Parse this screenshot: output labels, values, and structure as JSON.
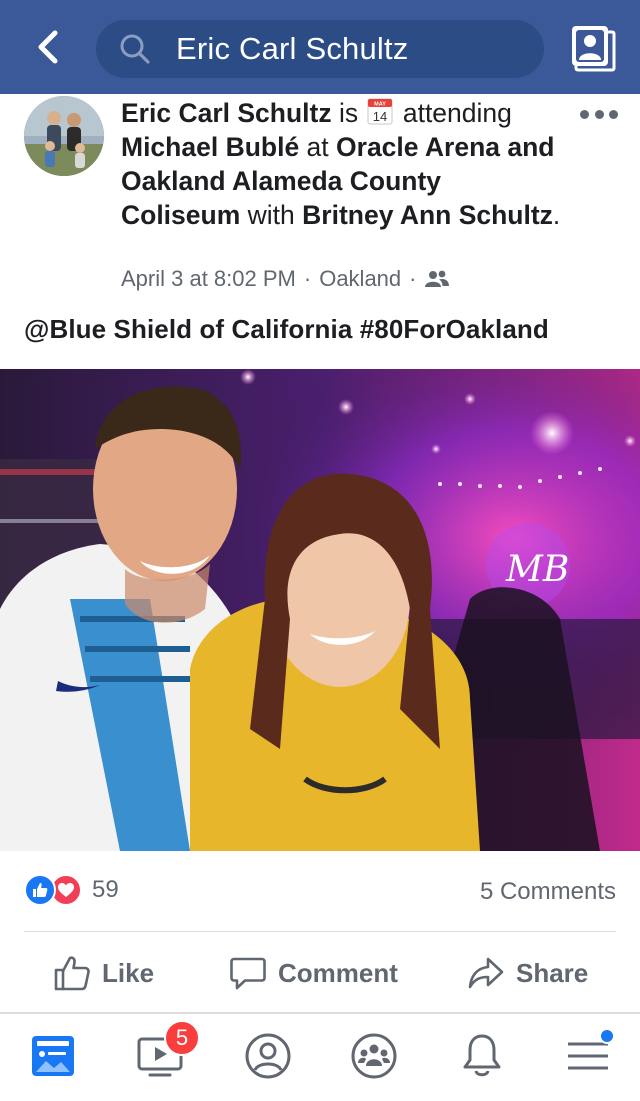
{
  "header": {
    "search_value": "Eric Carl Schultz",
    "colors": {
      "bar": "#3b5998",
      "search_bg": "#2c4c86"
    },
    "icons": [
      "back-arrow-icon",
      "search-icon",
      "profile-switch-icon"
    ]
  },
  "post": {
    "author": "Eric Carl Schultz",
    "is_text": " is ",
    "calendar_icon": {
      "name": "calendar-icon",
      "month": "MAY",
      "day": "14"
    },
    "attending_text": "attending",
    "event": "Michael Bublé",
    "at_text": " at ",
    "venue": "Oracle Arena and Oakland Alameda County Coliseum",
    "with_text": " with ",
    "with_person": "Britney Ann Schultz",
    "period": ".",
    "timestamp": "April 3 at 8:02 PM",
    "location": "Oakland",
    "dot": "·",
    "audience_icon": "friends-icon",
    "caption": "@Blue Shield of California #80ForOakland"
  },
  "stats": {
    "reaction_count": "59",
    "reaction_icons": [
      "like-reaction-icon",
      "love-reaction-icon"
    ],
    "comments": "5 Comments"
  },
  "actions": {
    "like": "Like",
    "comment": "Comment",
    "share": "Share"
  },
  "bottom_nav": {
    "items": [
      "news-feed-icon",
      "watch-icon",
      "profile-icon",
      "groups-icon",
      "notifications-icon",
      "menu-icon"
    ],
    "watch_badge": "5",
    "accent": "#1877f2"
  }
}
